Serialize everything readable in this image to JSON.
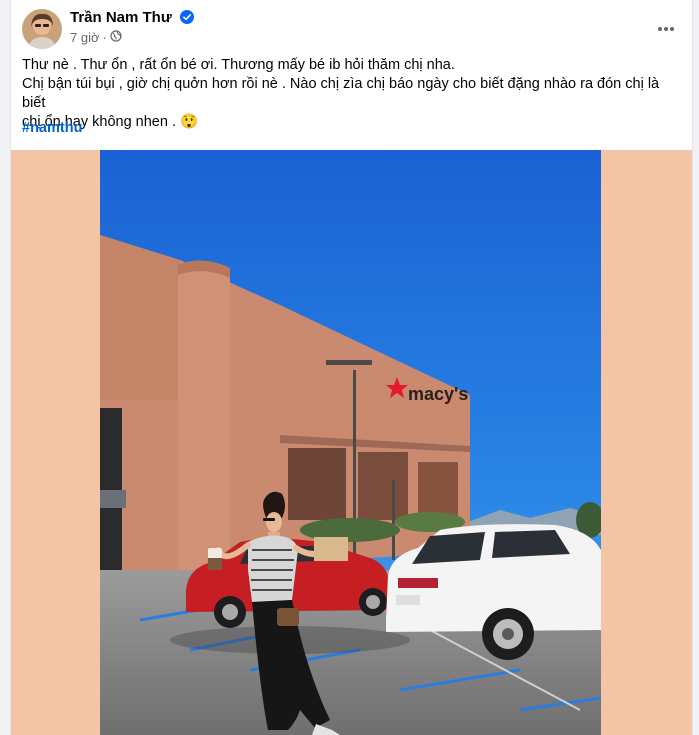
{
  "post": {
    "author_name": "Trần Nam Thư",
    "timestamp": "7 giờ",
    "separator": "·",
    "privacy_icon": "globe-icon",
    "line1": "Thư nè . Thư ổn , rất ổn bé ơi. Thương mấy bé ib hỏi thăm chị nha.",
    "line2": "Chị bận túi bụi , giờ chị quởn hơn rồi nè . Nào chị zìa chị báo ngày cho biết đặng nhào ra đón chị là biết",
    "line3": "chị ổn hay không nhen .",
    "emoji": "😲",
    "hashtag": "#namthu",
    "store_sign": "macy's"
  },
  "colors": {
    "media_background": "#f4c4a6",
    "sky": "#1e6fd9",
    "building": "#c98a70",
    "hashtag": "#0064d1",
    "verified": "#0866ff",
    "macys_star": "#e21a2c"
  },
  "icons": {
    "more": "more-horizontal-icon",
    "verified": "verified-badge-icon",
    "privacy": "globe-icon"
  }
}
